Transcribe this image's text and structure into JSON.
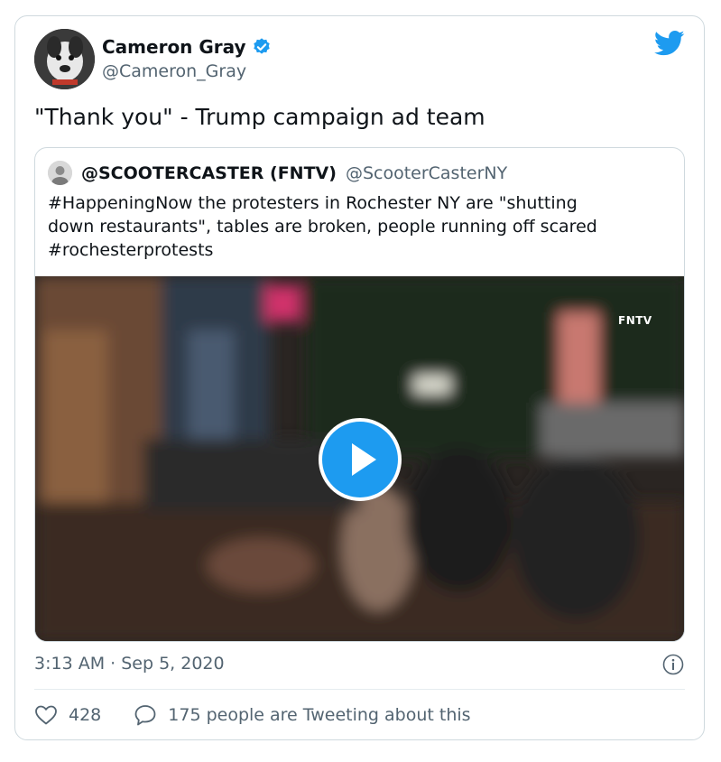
{
  "author": {
    "display_name": "Cameron Gray",
    "handle": "@Cameron_Gray",
    "verified": true,
    "avatar_icon": "dog-avatar"
  },
  "tweet": {
    "text": "\"Thank you\" - Trump campaign ad team"
  },
  "quoted": {
    "display_name": "@SCOOTERCASTER (FNTV)",
    "handle": "@ScooterCasterNY",
    "text_lines": [
      "#HappeningNow the protesters in Rochester NY are \"shutting",
      "down restaurants\", tables are broken, people running off scared",
      "#rochesterprotests"
    ],
    "video": {
      "watermark": "FNTV",
      "play_icon": "play-icon"
    }
  },
  "meta": {
    "timestamp": "3:13 AM · Sep 5, 2020"
  },
  "actions": {
    "likes": "428",
    "replies_label": "175 people are Tweeting about this"
  },
  "colors": {
    "accent": "#1d9bf0",
    "text": "#0f1419",
    "secondary": "#536471",
    "border": "#cfd9de"
  }
}
